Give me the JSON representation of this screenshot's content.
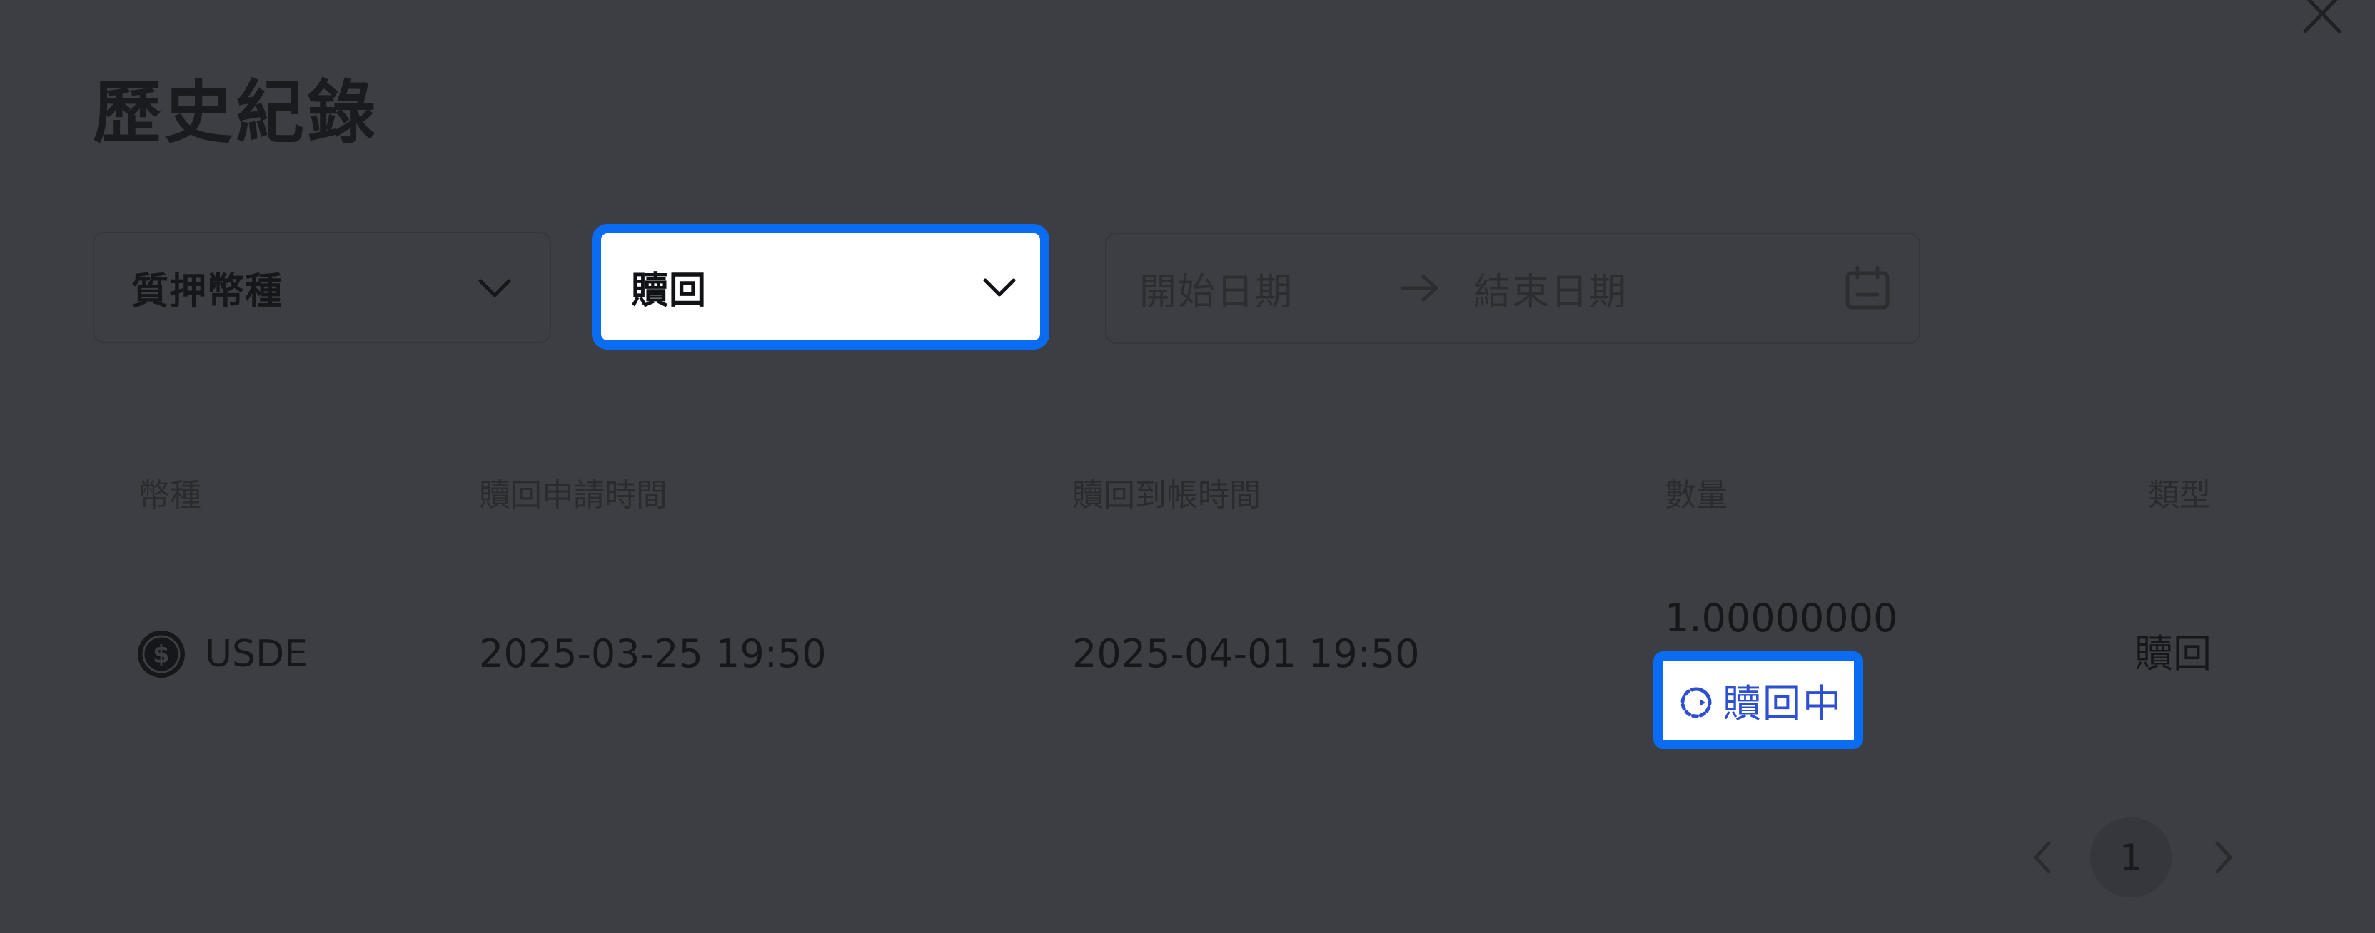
{
  "dialog": {
    "title": "歷史紀錄"
  },
  "filters": {
    "coin": {
      "label": "質押幣種"
    },
    "type": {
      "selected": "贖回"
    },
    "date": {
      "start_placeholder": "開始日期",
      "end_placeholder": "結束日期"
    }
  },
  "table": {
    "headers": {
      "coin": "幣種",
      "apply_time": "贖回申請時間",
      "arrival_time": "贖回到帳時間",
      "amount": "數量",
      "type": "類型"
    },
    "rows": [
      {
        "coin": "USDE",
        "apply_time": "2025-03-25 19:50",
        "arrival_time": "2025-04-01 19:50",
        "amount": "1.00000000",
        "status": "贖回中",
        "type": "贖回"
      }
    ]
  },
  "pagination": {
    "current_page": "1"
  },
  "colors": {
    "overlay": "#3d3e43",
    "accent": "#0a6cf2",
    "status_text": "#2d4fd1"
  }
}
